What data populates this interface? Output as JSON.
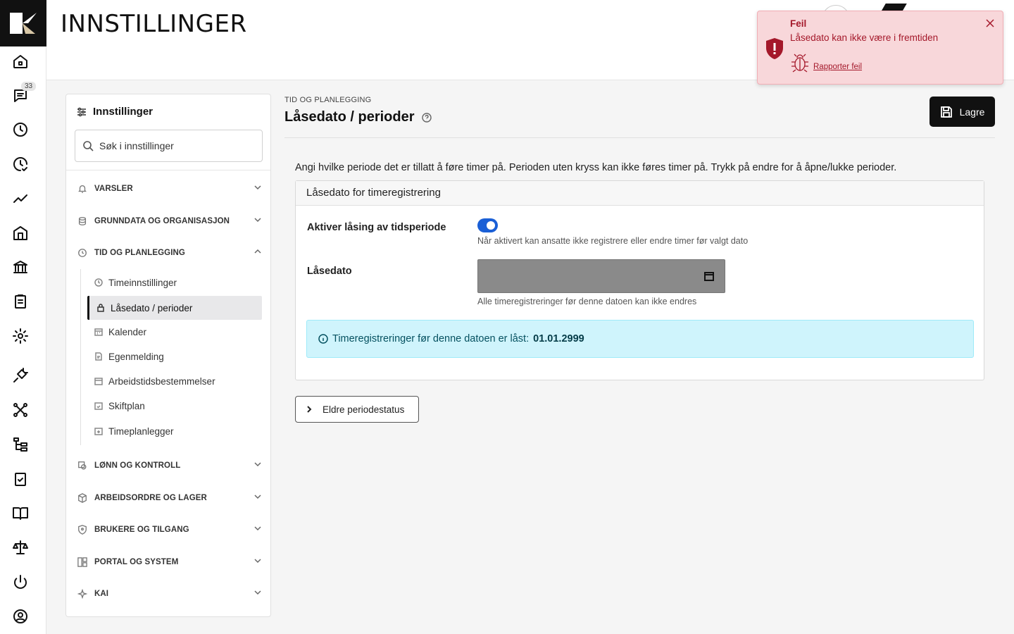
{
  "header": {
    "title": "INNSTILLINGER"
  },
  "rail": {
    "badge_count": "33"
  },
  "settings_panel": {
    "title": "Innstillinger",
    "search_placeholder": "Søk i innstillinger",
    "sections": [
      {
        "label": "VARSLER",
        "icon": "bell-icon"
      },
      {
        "label": "GRUNNDATA OG ORGANISASJON",
        "icon": "database-icon"
      },
      {
        "label": "TID OG PLANLEGGING",
        "icon": "clock-icon",
        "expanded": true
      },
      {
        "label": "LØNN OG KONTROLL",
        "icon": "payroll-icon"
      },
      {
        "label": "ARBEIDSORDRE OG LAGER",
        "icon": "box-icon"
      },
      {
        "label": "BRUKERE OG TILGANG",
        "icon": "shield-icon"
      },
      {
        "label": "PORTAL OG SYSTEM",
        "icon": "layout-icon"
      },
      {
        "label": "KAI",
        "icon": "sparkle-icon"
      }
    ],
    "sub_items": [
      {
        "label": "Timeinnstillinger"
      },
      {
        "label": "Låsedato / perioder",
        "active": true
      },
      {
        "label": "Kalender"
      },
      {
        "label": "Egenmelding"
      },
      {
        "label": "Arbeidstidsbestemmelser"
      },
      {
        "label": "Skiftplan"
      },
      {
        "label": "Timeplanlegger"
      }
    ]
  },
  "main": {
    "breadcrumb": "TID OG PLANLEGGING",
    "title": "Låsedato / perioder",
    "save_label": "Lagre",
    "intro": "Angi hvilke periode det er tillatt å føre timer på. Perioden uten kryss kan ikke føres timer på. Trykk på endre for å åpne/lukke perioder.",
    "card_title": "Låsedato for timeregistrering",
    "toggle_label": "Aktiver låsing av tidsperiode",
    "toggle_on": true,
    "toggle_hint": "Når aktivert kan ansatte ikke registrere eller endre timer før valgt dato",
    "date_label": "Låsedato",
    "date_value": "",
    "date_hint": "Alle timeregistreringer før denne datoen kan ikke endres",
    "info_prefix": "Timeregistreringer før denne datoen er låst:",
    "info_date": "01.01.2999",
    "older_button": "Eldre periodestatus"
  },
  "toast": {
    "title": "Feil",
    "message": "Låsedato kan ikke være i fremtiden",
    "link": "Rapporter feil"
  },
  "colors": {
    "accent": "#1a5fd6",
    "error_bg": "#f8d7da",
    "error_text": "#a4182a",
    "info_bg": "#cff4fc"
  }
}
